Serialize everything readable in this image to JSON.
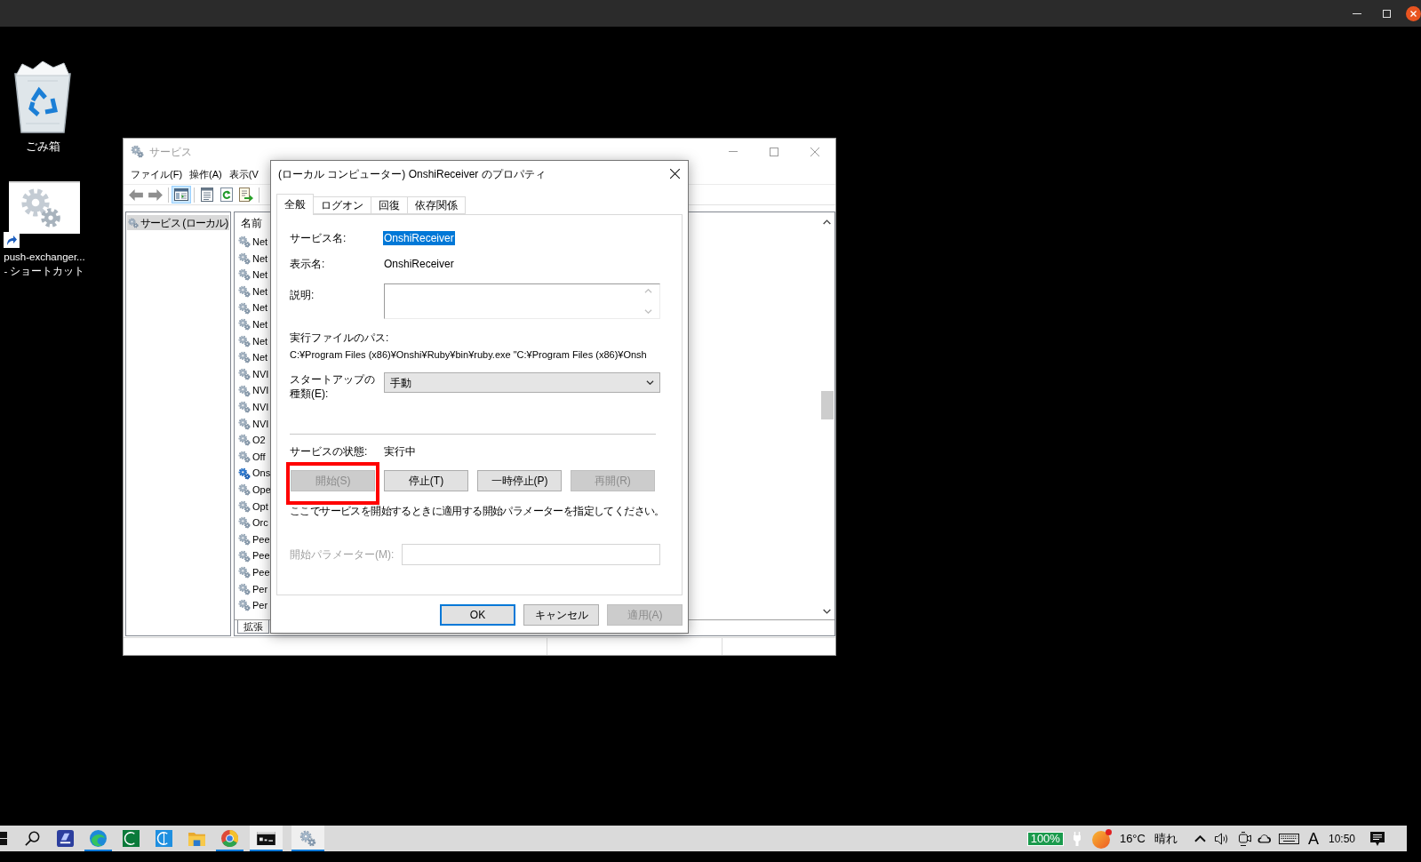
{
  "desktop_icons": [
    {
      "kind": "recycle-bin",
      "lines": [
        "ごみ箱"
      ]
    },
    {
      "kind": "shortcut",
      "lines": [
        "push-exchanger...",
        "- ショートカット"
      ]
    }
  ],
  "services_window": {
    "title": "サービス",
    "menu": [
      "ファイル(F)",
      "操作(A)",
      "表示(V"
    ],
    "toolbar": [
      [
        {
          "kind": "back",
          "selected": false
        },
        {
          "kind": "forward",
          "selected": false
        }
      ],
      [
        {
          "kind": "console-tree",
          "selected": true
        }
      ],
      [
        {
          "kind": "properties",
          "selected": false
        },
        {
          "kind": "refresh",
          "selected": false
        },
        {
          "kind": "export",
          "selected": false
        }
      ]
    ],
    "tree": [
      {
        "label": "サービス (ローカル)",
        "selected": true
      }
    ],
    "list": {
      "columns": [
        "名前"
      ],
      "rows": [
        {
          "name": "Net",
          "selected": false
        },
        {
          "name": "Net",
          "selected": false
        },
        {
          "name": "Net",
          "selected": false
        },
        {
          "name": "Net",
          "selected": false
        },
        {
          "name": "Net",
          "selected": false
        },
        {
          "name": "Net",
          "selected": false
        },
        {
          "name": "Net",
          "selected": false
        },
        {
          "name": "Net",
          "selected": false
        },
        {
          "name": "NVI",
          "selected": false
        },
        {
          "name": "NVI",
          "selected": false
        },
        {
          "name": "NVI",
          "selected": false
        },
        {
          "name": "NVI",
          "selected": false
        },
        {
          "name": "O2",
          "selected": false
        },
        {
          "name": "Off",
          "selected": false
        },
        {
          "name": "Ons",
          "selected": true
        },
        {
          "name": "Ope",
          "selected": false
        },
        {
          "name": "Opt",
          "selected": false
        },
        {
          "name": "Orc",
          "selected": false
        },
        {
          "name": "Pee",
          "selected": false
        },
        {
          "name": "Pee",
          "selected": false
        },
        {
          "name": "Pee",
          "selected": false
        },
        {
          "name": "Per",
          "selected": false
        },
        {
          "name": "Per",
          "selected": false
        }
      ]
    },
    "view_tabs": [
      {
        "label": "拡張",
        "selected": true
      }
    ]
  },
  "dialog": {
    "title": "(ローカル コンピューター) OnshiReceiver のプロパティ",
    "tabs": [
      {
        "label": "全般",
        "selected": true
      },
      {
        "label": "ログオン",
        "selected": false
      },
      {
        "label": "回復",
        "selected": false
      },
      {
        "label": "依存関係",
        "selected": false
      }
    ],
    "general": {
      "service_name": {
        "label": "サービス名:",
        "value": "OnshiReceiver",
        "selected": true
      },
      "display_name": {
        "label": "表示名:",
        "value": "OnshiReceiver"
      },
      "description": {
        "label": "説明:"
      },
      "executable_path": {
        "label": "実行ファイルのパス:",
        "value": "C:¥Program Files (x86)¥Onshi¥Ruby¥bin¥ruby.exe \"C:¥Program Files (x86)¥Onsh"
      },
      "startup_type": {
        "label_lines": [
          "スタートアップの",
          "種類(E):"
        ],
        "value": "手動"
      },
      "service_status": {
        "label": "サービスの状態:",
        "value": "実行中"
      },
      "control_buttons": [
        {
          "label": "開始(S)",
          "disabled": true,
          "highlighted": true
        },
        {
          "label": "停止(T)",
          "disabled": false,
          "highlighted": false
        },
        {
          "label": "一時停止(P)",
          "disabled": false,
          "highlighted": false
        },
        {
          "label": "再開(R)",
          "disabled": true,
          "highlighted": false
        }
      ],
      "hint": "ここでサービスを開始するときに適用する開始パラメーターを指定してください。",
      "start_parameters": {
        "label": "開始パラメーター(M):",
        "disabled": true
      }
    },
    "buttons": [
      {
        "label": "OK",
        "default": true,
        "disabled": false
      },
      {
        "label": "キャンセル",
        "default": false,
        "disabled": false
      },
      {
        "label": "適用(A)",
        "default": false,
        "disabled": true
      }
    ]
  },
  "taskbar": {
    "apps": [
      {
        "kind": "start",
        "running": false,
        "active": false
      },
      {
        "kind": "search",
        "running": false,
        "active": false
      },
      {
        "kind": "scanner",
        "running": false,
        "active": false
      },
      {
        "kind": "browser-wave",
        "running": true,
        "active": false
      },
      {
        "kind": "green-ring",
        "running": false,
        "active": false
      },
      {
        "kind": "blue-ring",
        "running": false,
        "active": false
      },
      {
        "kind": "folder",
        "running": false,
        "active": false
      },
      {
        "kind": "browser-ring",
        "running": true,
        "active": false
      },
      {
        "kind": "console",
        "running": true,
        "active": true
      },
      {
        "kind": "gears",
        "running": true,
        "active": true
      }
    ],
    "battery": "100%",
    "weather": {
      "temperature": "16°C",
      "condition": "晴れ"
    },
    "input_mode": "A",
    "clock": "10:50"
  }
}
